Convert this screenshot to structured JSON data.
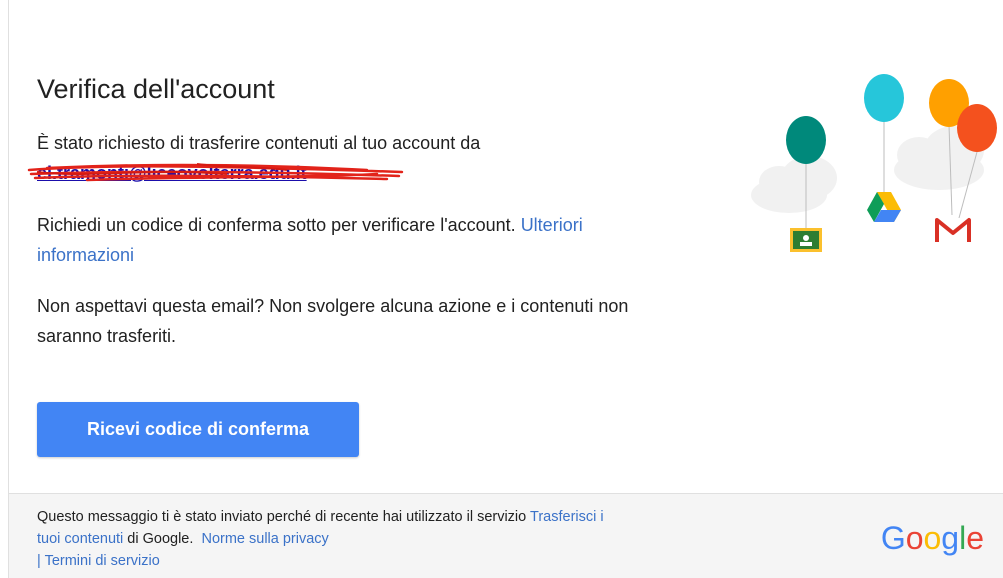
{
  "title": "Verifica dell'account",
  "intro_text": "È stato richiesto di trasferire contenuti al tuo account da",
  "redacted_email": "el.tramonti@liceovolterra.edu.it",
  "request_text": "Richiedi un codice di conferma sotto per verificare l'account.",
  "more_info_link": "Ulteriori informazioni",
  "unexpected_text": "Non aspettavi questa email? Non svolgere alcuna azione e i contenuti non saranno trasferiti.",
  "cta_button": "Ricevi codice di conferma",
  "footer": {
    "text_before": "Questo messaggio ti è stato inviato perché di recente hai utilizzato il servizio",
    "transfer_link": "Trasferisci i tuoi contenuti",
    "text_middle": "di Google.",
    "privacy_link": "Norme sulla privacy",
    "separator": "|",
    "terms_link": "Termini di servizio"
  },
  "logo": {
    "letters": [
      "G",
      "o",
      "o",
      "g",
      "l",
      "e"
    ],
    "colors": [
      "#4285f4",
      "#ea4335",
      "#fbbc05",
      "#4285f4",
      "#34a853",
      "#ea4335"
    ]
  },
  "illustration": {
    "balloon_colors": [
      "#00897b",
      "#26c6da",
      "#ffa000",
      "#f4511e"
    ],
    "icons": [
      "google-classroom-icon",
      "google-drive-icon",
      "gmail-icon"
    ]
  }
}
